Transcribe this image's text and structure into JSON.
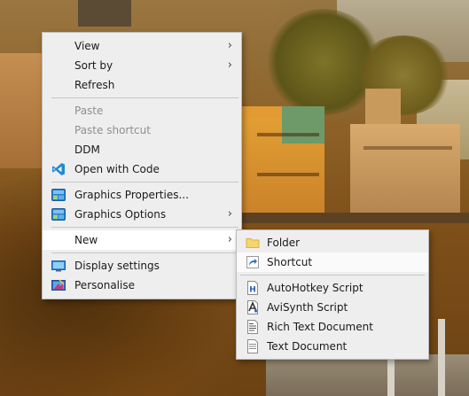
{
  "main_menu": {
    "items": [
      {
        "label": "View",
        "submenu": true,
        "disabled": false
      },
      {
        "label": "Sort by",
        "submenu": true,
        "disabled": false
      },
      {
        "label": "Refresh",
        "submenu": false,
        "disabled": false
      },
      {
        "label": "Paste",
        "submenu": false,
        "disabled": true
      },
      {
        "label": "Paste shortcut",
        "submenu": false,
        "disabled": true
      },
      {
        "label": "DDM",
        "submenu": false,
        "disabled": false
      },
      {
        "label": "Open with Code",
        "submenu": false,
        "disabled": false,
        "icon": "vscode-icon"
      },
      {
        "label": "Graphics Properties...",
        "submenu": false,
        "disabled": false,
        "icon": "intel-graphics-icon"
      },
      {
        "label": "Graphics Options",
        "submenu": true,
        "disabled": false,
        "icon": "intel-graphics-icon"
      },
      {
        "label": "New",
        "submenu": true,
        "disabled": false,
        "highlighted": true
      },
      {
        "label": "Display settings",
        "submenu": false,
        "disabled": false,
        "icon": "display-icon"
      },
      {
        "label": "Personalise",
        "submenu": false,
        "disabled": false,
        "icon": "personalise-icon"
      }
    ],
    "arrow_glyph": "›"
  },
  "new_submenu": {
    "items": [
      {
        "label": "Folder",
        "icon": "folder-icon"
      },
      {
        "label": "Shortcut",
        "icon": "shortcut-icon",
        "highlighted": true
      },
      {
        "label": "AutoHotkey Script",
        "icon": "autohotkey-icon"
      },
      {
        "label": "AviSynth Script",
        "icon": "avisynth-icon"
      },
      {
        "label": "Rich Text Document",
        "icon": "rich-text-icon"
      },
      {
        "label": "Text Document",
        "icon": "text-document-icon"
      }
    ]
  },
  "colors": {
    "menu_background": "#eeeeee",
    "highlight": "#ffffff",
    "disabled_text": "#8f8f8f",
    "vscode_blue": "#1f8ad2",
    "folder_yellow": "#f6d56a"
  }
}
